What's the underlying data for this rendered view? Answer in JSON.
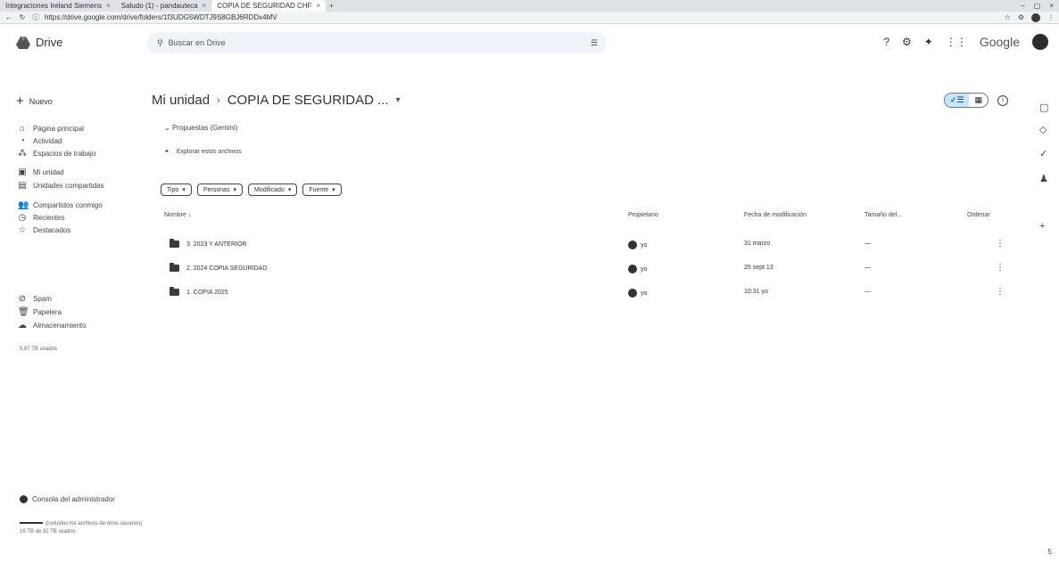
{
  "browser": {
    "tabs": [
      {
        "label": "Integraciones Ireland Siemens",
        "active": false
      },
      {
        "label": "Saludo (1) - pandauteca",
        "active": false
      },
      {
        "label": "COPIA DE SEGURIDAD CHF",
        "active": true
      }
    ],
    "new_tab": "+",
    "url": "https://drive.google.com/drive/folders/1f3UDG5WDTJ9S8GBJ6RDDx4MV"
  },
  "header": {
    "app_name": "Drive",
    "search_placeholder": "Buscar en Drive",
    "google_label": "Google"
  },
  "sidebar": {
    "new_label": "Nuevo",
    "items": [
      {
        "label": "Página principal",
        "icon": "home-icon",
        "glyph": "⌂"
      },
      {
        "label": "Actividad",
        "icon": "activity-icon",
        "glyph": "◔"
      },
      {
        "label": "Espacios de trabajo",
        "icon": "workspaces-icon",
        "glyph": "⁂"
      },
      {
        "label": "Mi unidad",
        "icon": "my-drive-icon",
        "glyph": "▣"
      },
      {
        "label": "Unidades compartidas",
        "icon": "shared-drives-icon",
        "glyph": "▤"
      },
      {
        "label": "Compartidos conmigo",
        "icon": "shared-with-me-icon",
        "glyph": "👥"
      },
      {
        "label": "Recientes",
        "icon": "recent-icon",
        "glyph": "◷"
      },
      {
        "label": "Destacados",
        "icon": "starred-icon",
        "glyph": "☆"
      },
      {
        "label": "Spam",
        "icon": "spam-icon",
        "glyph": "⊘"
      },
      {
        "label": "Papelera",
        "icon": "trash-icon",
        "glyph": "🗑"
      },
      {
        "label": "Almacenamiento",
        "icon": "storage-icon",
        "glyph": "☁"
      }
    ],
    "storage_note": "5,87 TB usados",
    "admin_label": "Consola del administrador",
    "bottom_note": "16 TB de 32 TB usados",
    "bottom_link": "(incluidos los archivos de otros usuarios)"
  },
  "main": {
    "breadcrumb": [
      "Mi unidad",
      "COPIA DE SEGURIDAD ..."
    ],
    "suggested_toggle": "Propuestas (Gemini)",
    "suggest_card": "Explorar estos archivos",
    "filters": [
      "Tipo",
      "Personas",
      "Modificado",
      "Fuente"
    ],
    "columns": {
      "name": "Nombre ↓",
      "owner": "Propietario",
      "modified": "Fecha de modificación",
      "size": "Tamaño del...",
      "sort": "Ordenar"
    },
    "rows": [
      {
        "name": "3. 2023 Y ANTERIOR",
        "owner": "yo",
        "modified": "31 marzo",
        "size": "—"
      },
      {
        "name": "2. 2024 COPIA SEGURIDAD",
        "owner": "yo",
        "modified": "25 sept 13",
        "size": "—"
      },
      {
        "name": "1. COPIA 2025",
        "owner": "yo",
        "modified": "10:31 yo",
        "size": "—"
      }
    ]
  },
  "page_number": "5",
  "colors": {
    "accent_selected": "#c2e7ff",
    "search_bg": "#f0f4f9"
  }
}
